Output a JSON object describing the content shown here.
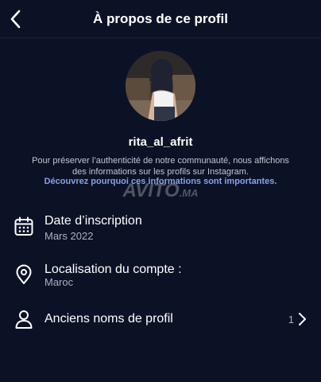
{
  "header": {
    "title": "À propos de ce profil"
  },
  "profile": {
    "username": "rita_al_afrit",
    "description": "Pour préserver l’authenticité de notre communauté, nous affichons des informations sur les profils sur Instagram.",
    "learn_more": "Découvrez pourquoi ces informations sont importantes."
  },
  "watermark": {
    "brand": "AVITO",
    "suffix": ".MA"
  },
  "rows": [
    {
      "icon": "calendar-icon",
      "title": "Date d’inscription",
      "value": "Mars 2022"
    },
    {
      "icon": "location-pin-icon",
      "title": "Localisation du compte :",
      "value": "Maroc"
    },
    {
      "icon": "person-icon",
      "title": "Anciens noms de profil",
      "count": "1"
    }
  ],
  "colors": {
    "background": "#0b1226",
    "link": "#8ba0e3",
    "secondary_text": "#aab0be"
  }
}
